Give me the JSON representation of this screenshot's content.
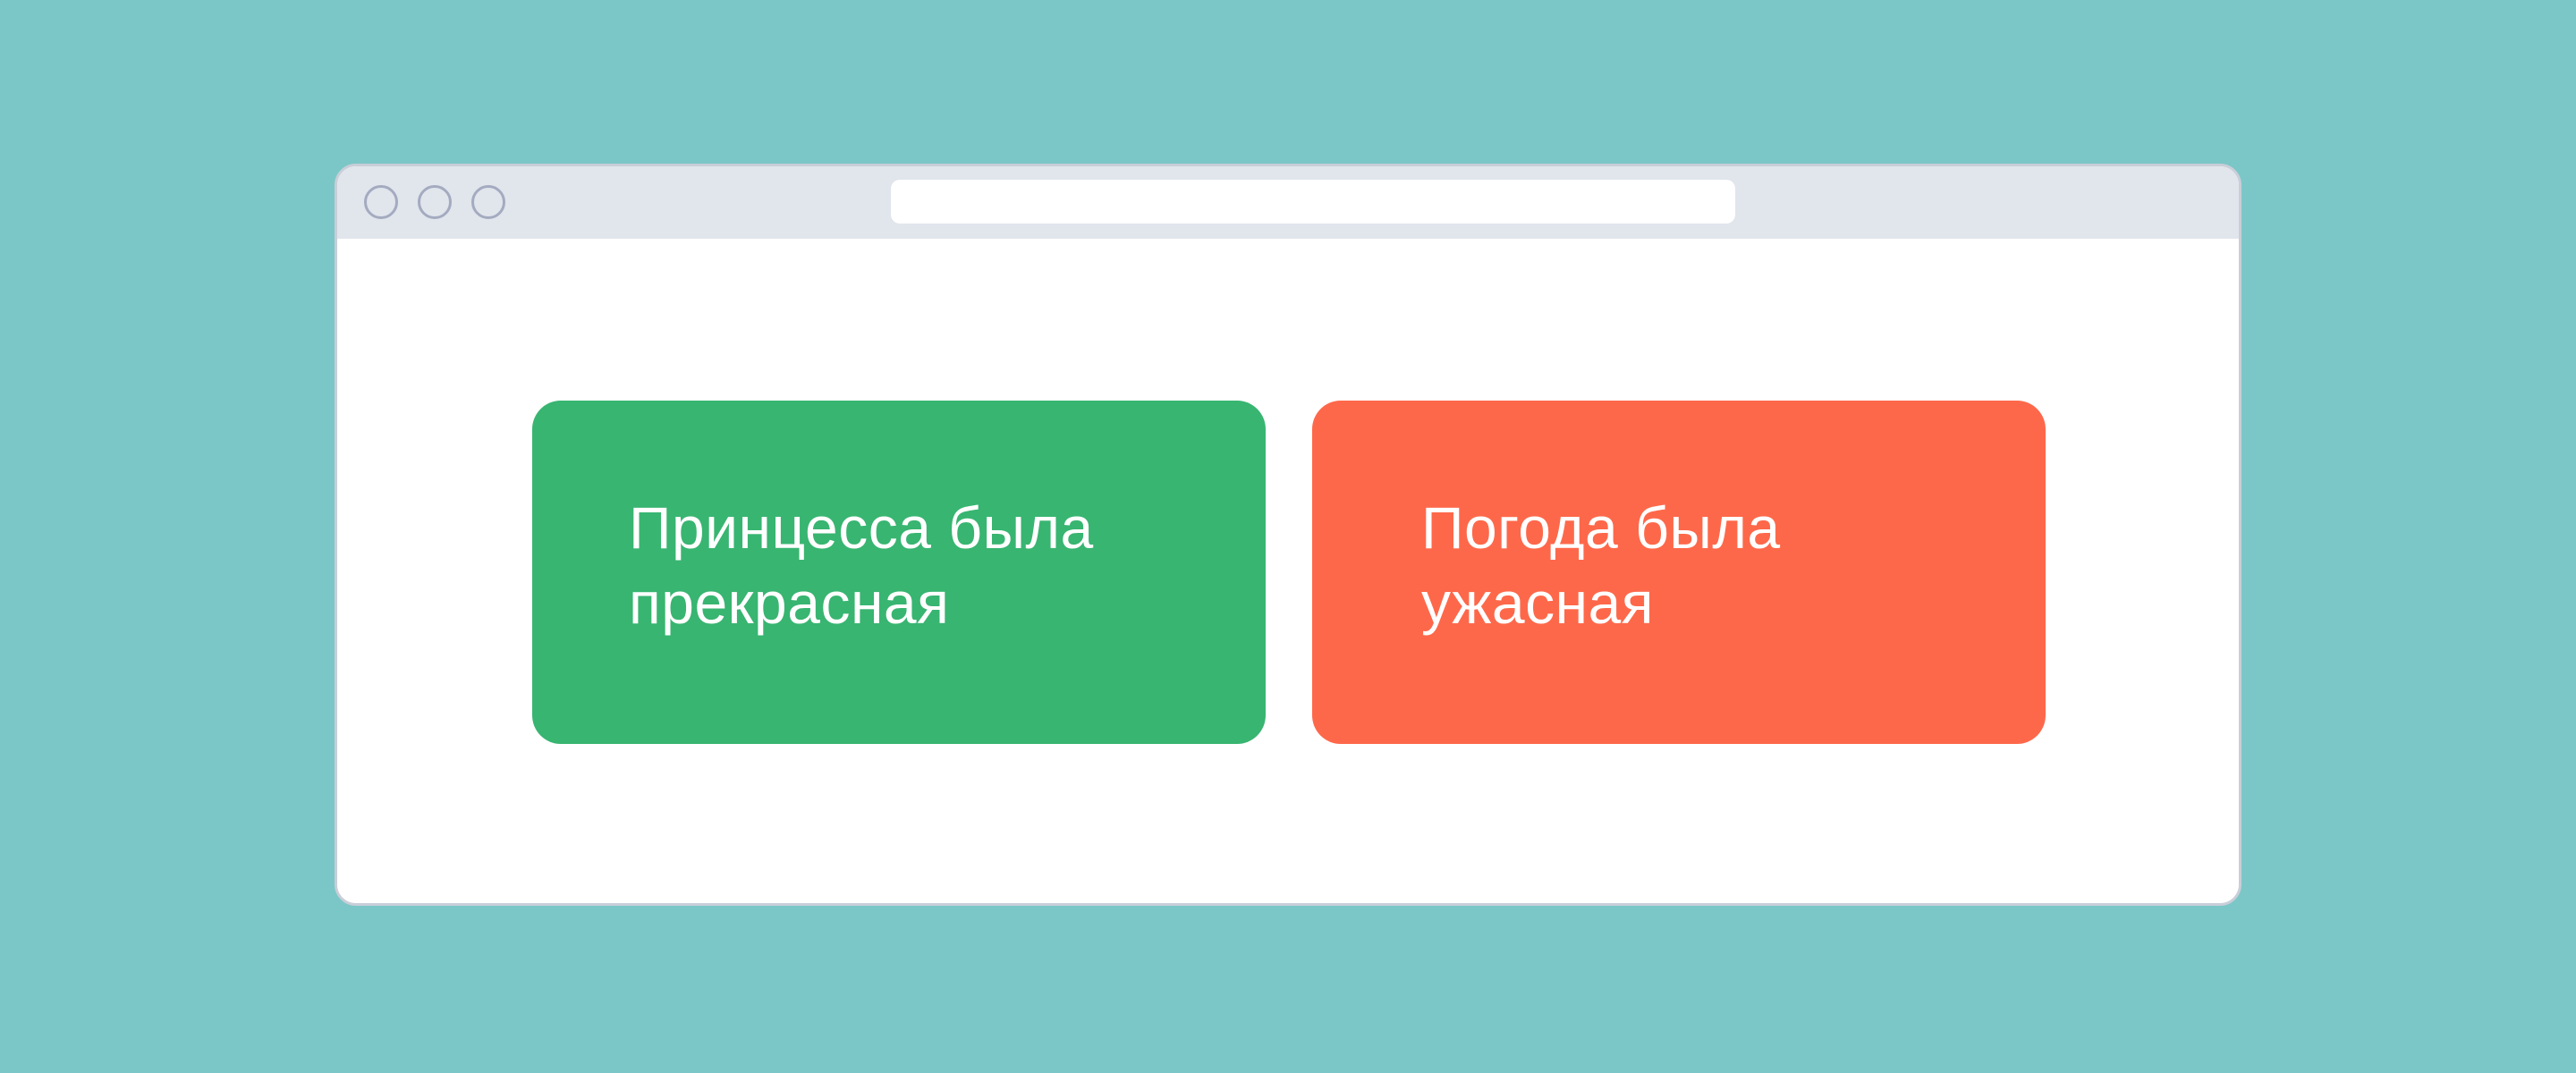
{
  "colors": {
    "background": "#7bc7c7",
    "window_border": "#c9ced8",
    "title_bar": "#e1e5ec",
    "traffic_dot_stroke": "#a4abc0",
    "address_bar": "#ffffff",
    "card_good": "#38b571",
    "card_bad": "#fe684a",
    "card_text": "#ffffff"
  },
  "window": {
    "traffic_lights": [
      "circle-icon",
      "circle-icon",
      "circle-icon"
    ],
    "address_bar_text": ""
  },
  "cards": [
    {
      "variant": "good",
      "text": "Принцесса была\nпрекрасная"
    },
    {
      "variant": "bad",
      "text": "Погода была\nужасная"
    }
  ]
}
